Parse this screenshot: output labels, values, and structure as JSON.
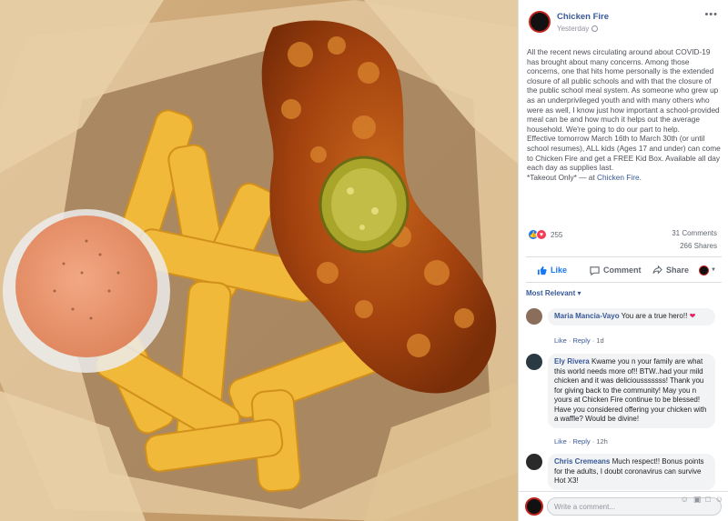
{
  "post": {
    "page_name": "Chicken Fire",
    "time": "Yesterday",
    "more_label": "•••",
    "text_lines": [
      "All the recent news circulating around about COVID-19 has brought about many concerns. Among those concerns, one that hits home personally is the extended closure of all public schools and with that the closure of the public school meal system. As someone who grew up as an underprivileged youth and with many others who were as well, I know just how important a school-provided meal can be and how much it helps out the average household. We're going to do our part to help.",
      "Effective tomorrow March 16th to March 30th (or until school resumes), ALL kids (Ages 17 and under) can come to Chicken Fire and get a FREE Kid Box. Available all day each day as supplies last.",
      "*Takeout Only*"
    ],
    "at_text": " — at ",
    "at_place": "Chicken Fire",
    "at_end": "."
  },
  "stats": {
    "reactions": "255",
    "comments": "31 Comments",
    "shares": "266 Shares"
  },
  "actions": {
    "like": "Like",
    "comment": "Comment",
    "share": "Share"
  },
  "sort_label": "Most Relevant ▾",
  "comments": [
    {
      "name": "Maria Mancia-Vayo",
      "text": "You are a true hero!!",
      "emoji": "❤",
      "like": "Like",
      "reply": "Reply",
      "time": "1d"
    },
    {
      "name": "Ely Rivera",
      "text": "Kwame you n your family are what this world needs more of!! BTW..had your mild chicken and it was deliciousssssss! Thank you for giving back to the community! May you n yours at Chicken Fire continue to be blessed! Have you considered offering your chicken with a waffle? Would be divine!",
      "like": "Like",
      "reply": "Reply",
      "time": "12h"
    },
    {
      "name": "Chris Cremeans",
      "text": "Much respect!! Bonus points for the adults, I doubt coronavirus can survive Hot X3!"
    }
  ],
  "composer": {
    "placeholder": "Write a comment..."
  },
  "colors": {
    "link": "#385898",
    "like_blue": "#1877f2",
    "love_red": "#f33e58"
  }
}
